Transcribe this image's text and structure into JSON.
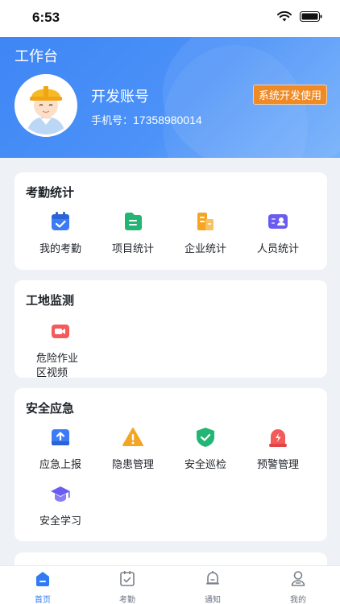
{
  "status_bar": {
    "time": "6:53"
  },
  "header": {
    "title": "工作台",
    "account_name": "开发账号",
    "phone_label": "手机号：",
    "phone_value": "17358980014",
    "role_badge": "系统开发使用"
  },
  "sections": [
    {
      "title": "考勤统计",
      "items": [
        {
          "label": "我的考勤",
          "icon": "calendar-check-icon",
          "color": "#3b7cf6"
        },
        {
          "label": "项目统计",
          "icon": "folder-icon",
          "color": "#22b573"
        },
        {
          "label": "企业统计",
          "icon": "building-icon",
          "color": "#f5a524"
        },
        {
          "label": "人员统计",
          "icon": "id-card-icon",
          "color": "#6b5cf0"
        }
      ]
    },
    {
      "title": "工地监测",
      "items": [
        {
          "label": "危险作业区视频",
          "icon": "video-camera-icon",
          "color": "#f35b5b"
        }
      ]
    },
    {
      "title": "安全应急",
      "items": [
        {
          "label": "应急上报",
          "icon": "upload-icon",
          "color": "#3b7cf6"
        },
        {
          "label": "隐患管理",
          "icon": "warning-icon",
          "color": "#f5a524"
        },
        {
          "label": "安全巡检",
          "icon": "shield-check-icon",
          "color": "#22b573"
        },
        {
          "label": "预警管理",
          "icon": "alarm-icon",
          "color": "#f35b5b"
        },
        {
          "label": "安全学习",
          "icon": "graduation-cap-icon",
          "color": "#6b5cf0"
        }
      ]
    }
  ],
  "tabbar": {
    "items": [
      {
        "label": "首页",
        "icon": "home-icon",
        "active": true
      },
      {
        "label": "考勤",
        "icon": "attendance-icon",
        "active": false
      },
      {
        "label": "通知",
        "icon": "bell-icon",
        "active": false
      },
      {
        "label": "我的",
        "icon": "user-icon",
        "active": false
      }
    ]
  },
  "colors": {
    "brand": "#3f86f5",
    "active_tab": "#2f7bf5",
    "badge": "#f08a24"
  }
}
